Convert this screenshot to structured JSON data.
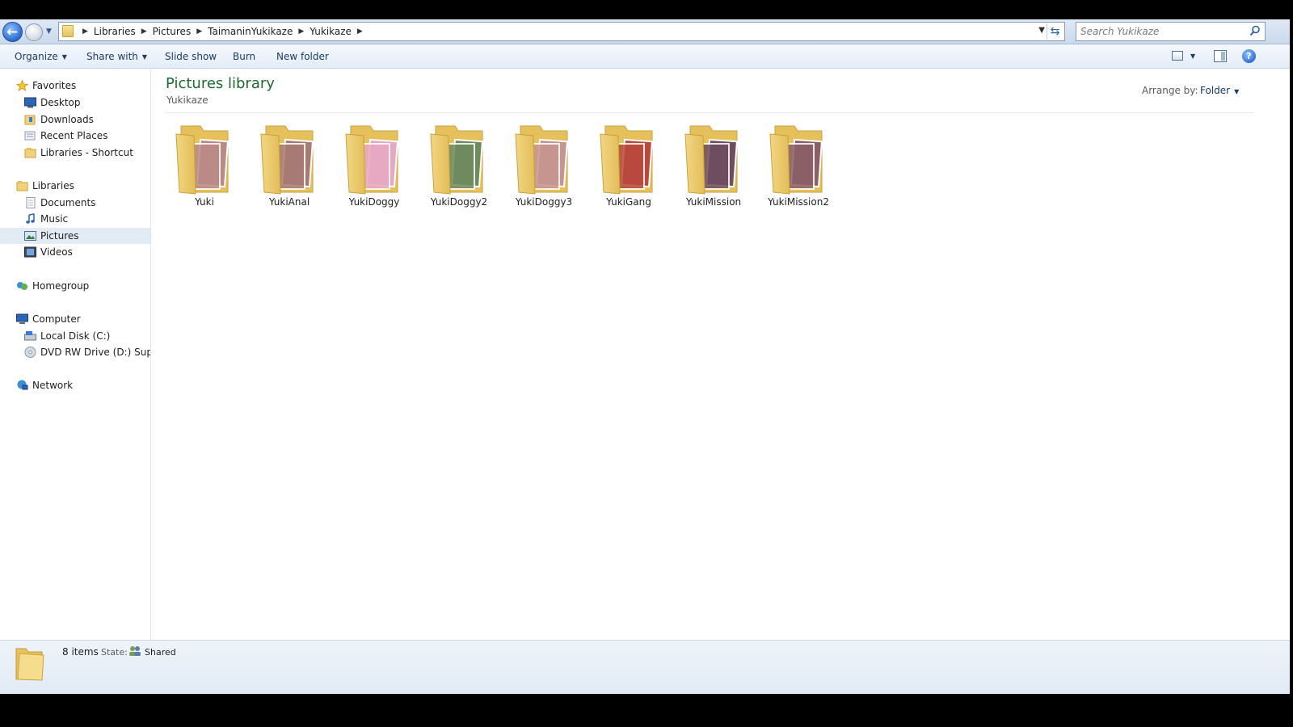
{
  "address_bar": {
    "crumbs": [
      "Libraries",
      "Pictures",
      "TaimaninYukikaze",
      "Yukikaze"
    ],
    "search_placeholder": "Search Yukikaze"
  },
  "command_bar": {
    "organize": "Organize",
    "share_with": "Share with",
    "slide_show": "Slide show",
    "burn": "Burn",
    "new_folder": "New folder",
    "help": "?"
  },
  "nav": {
    "favorites": "Favorites",
    "desktop": "Desktop",
    "downloads": "Downloads",
    "recent_places": "Recent Places",
    "libraries_shortcut": "Libraries - Shortcut",
    "libraries": "Libraries",
    "documents": "Documents",
    "music": "Music",
    "pictures": "Pictures",
    "videos": "Videos",
    "homegroup": "Homegroup",
    "computer": "Computer",
    "local_disk": "Local Disk (C:)",
    "dvd_drive": "DVD RW Drive (D:) SuperM",
    "network": "Network",
    "selected": "Pictures"
  },
  "content": {
    "title": "Pictures library",
    "subtitle": "Yukikaze",
    "arrange_label": "Arrange by:",
    "arrange_value": "Folder",
    "folders": [
      {
        "name": "Yuki",
        "tint": "#b98a86"
      },
      {
        "name": "YukiAnal",
        "tint": "#a77b74"
      },
      {
        "name": "YukiDoggy",
        "tint": "#e7a9c1"
      },
      {
        "name": "YukiDoggy2",
        "tint": "#6f8a5e"
      },
      {
        "name": "YukiDoggy3",
        "tint": "#c79590"
      },
      {
        "name": "YukiGang",
        "tint": "#b8493c"
      },
      {
        "name": "YukiMission",
        "tint": "#6d4d5e"
      },
      {
        "name": "YukiMission2",
        "tint": "#8a6066"
      }
    ]
  },
  "details": {
    "count": "8 items",
    "state_label": "State:",
    "state_value": "Shared"
  }
}
